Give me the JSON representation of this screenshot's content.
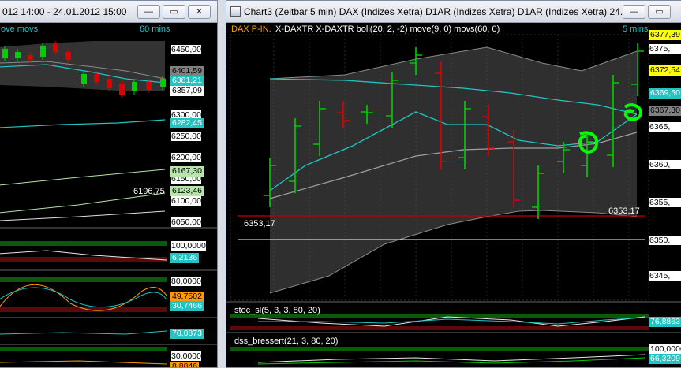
{
  "left_window": {
    "title": "012 14:00 - 24.01.2012 15:00",
    "header": {
      "text": "ove movs",
      "interval": "60 mins"
    },
    "price_axis": [
      "6450,00",
      "6300,00",
      "6250,00",
      "6200,00",
      "6150,00",
      "6100,00",
      "6050,00"
    ],
    "price_tags": [
      {
        "text": "6401,59",
        "bg": "#808080",
        "fg": "#000000"
      },
      {
        "text": "6381,21",
        "bg": "#22c3c3",
        "fg": "#ffffff"
      },
      {
        "text": "6357,09",
        "bg": "#ffffff",
        "fg": "#000000"
      },
      {
        "text": "6282,45",
        "bg": "#22c3c3",
        "fg": "#ffffff"
      },
      {
        "text": "6167,30",
        "bg": "#b7e4a8",
        "fg": "#000000"
      },
      {
        "text": "6123,46",
        "bg": "#b7e4a8",
        "fg": "#000000"
      }
    ],
    "inline_label": "6196,75",
    "ind1_axis": "100,0000",
    "ind1_tag": "6,2136",
    "ind2_axis": "80,0000",
    "ind2_tags": [
      "49,7502",
      "30,7466"
    ],
    "ind3_tag": "70,0873",
    "ind4_axis": "30,0000",
    "ind4_tag": "8,8846"
  },
  "right_window": {
    "title": "Chart3 (Zeitbar 5 min)  DAX (Indizes Xetra) D1AR (Indizes Xetra) D1AR (Indizes Xetra) 24...",
    "header": {
      "symbol": "DAX P-IN.",
      "studies": "X-DAXTR X-DAXTR boll(20, 2, -2) move(9, 0) movs(60, 0)",
      "interval": "5 mins"
    },
    "price_axis": [
      "6375,",
      "6365,",
      "6360,",
      "6355,",
      "6350,",
      "6345,"
    ],
    "price_tags": [
      {
        "text": "6377,39",
        "bg": "#ffff00",
        "fg": "#000000"
      },
      {
        "text": "6372,54",
        "bg": "#ffff00",
        "fg": "#000000"
      },
      {
        "text": "6369,50",
        "bg": "#22c3c3",
        "fg": "#ffffff"
      },
      {
        "text": "6367,30",
        "bg": "#808080",
        "fg": "#000000"
      }
    ],
    "line_label_right": "6353,17",
    "line_label_left": "6353,17",
    "ind1_header": "stoc_sl(5, 3, 3, 80, 20)",
    "ind1_tag": "76,8863",
    "ind2_header": "dss_bressert(21, 3, 80, 20)",
    "ind2_tags": [
      "66,3209",
      "100,0000"
    ]
  },
  "window_buttons": {
    "minimize": "—",
    "restore": "▭",
    "close": "✕"
  },
  "colors": {
    "bull": "#00d000",
    "bear": "#e00000",
    "boll_band": "#555555",
    "move": "#22c3c3",
    "movs": "#a0a0a0",
    "accent_green": "#00ff00"
  }
}
